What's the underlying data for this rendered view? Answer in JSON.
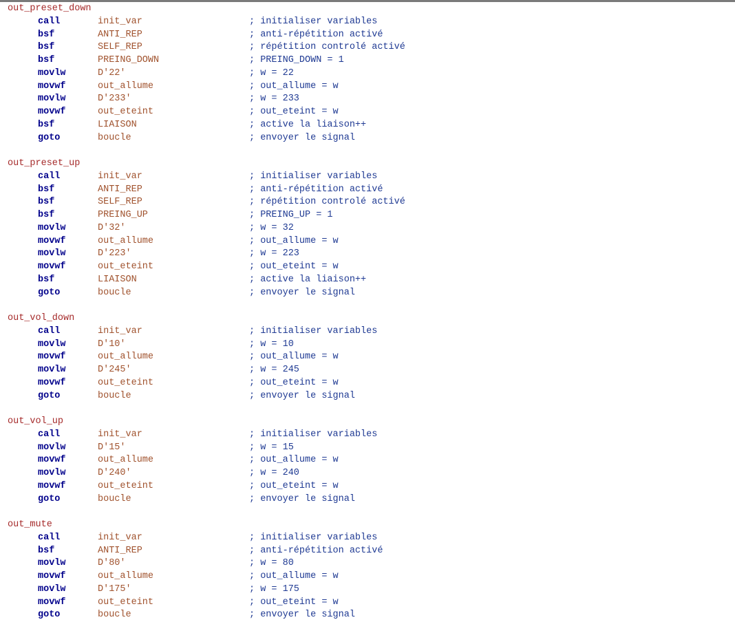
{
  "blocks": [
    {
      "label": "out_preset_down",
      "lines": [
        {
          "instr": "call",
          "operand": "init_var",
          "comment": "; initialiser variables"
        },
        {
          "instr": "bsf",
          "operand": "ANTI_REP",
          "comment": "; anti-répétition activé"
        },
        {
          "instr": "bsf",
          "operand": "SELF_REP",
          "comment": "; répétition controlé activé"
        },
        {
          "instr": "bsf",
          "operand": "PREING_DOWN",
          "comment": "; PREING_DOWN = 1"
        },
        {
          "instr": "movlw",
          "operand": "D'22'",
          "comment": "; w = 22"
        },
        {
          "instr": "movwf",
          "operand": "out_allume",
          "comment": "; out_allume = w"
        },
        {
          "instr": "movlw",
          "operand": "D'233'",
          "comment": "; w = 233"
        },
        {
          "instr": "movwf",
          "operand": "out_eteint",
          "comment": "; out_eteint = w"
        },
        {
          "instr": "bsf",
          "operand": "LIAISON",
          "comment": "; active la liaison++"
        },
        {
          "instr": "goto",
          "operand": "boucle",
          "comment": "; envoyer le signal"
        }
      ]
    },
    {
      "label": "out_preset_up",
      "lines": [
        {
          "instr": "call",
          "operand": "init_var",
          "comment": "; initialiser variables"
        },
        {
          "instr": "bsf",
          "operand": "ANTI_REP",
          "comment": "; anti-répétition activé"
        },
        {
          "instr": "bsf",
          "operand": "SELF_REP",
          "comment": "; répétition controlé activé"
        },
        {
          "instr": "bsf",
          "operand": "PREING_UP",
          "comment": "; PREING_UP = 1"
        },
        {
          "instr": "movlw",
          "operand": "D'32'",
          "comment": "; w = 32"
        },
        {
          "instr": "movwf",
          "operand": "out_allume",
          "comment": "; out_allume = w"
        },
        {
          "instr": "movlw",
          "operand": "D'223'",
          "comment": "; w = 223"
        },
        {
          "instr": "movwf",
          "operand": "out_eteint",
          "comment": "; out_eteint = w"
        },
        {
          "instr": "bsf",
          "operand": "LIAISON",
          "comment": "; active la liaison++"
        },
        {
          "instr": "goto",
          "operand": "boucle",
          "comment": "; envoyer le signal"
        }
      ]
    },
    {
      "label": "out_vol_down",
      "lines": [
        {
          "instr": "call",
          "operand": "init_var",
          "comment": "; initialiser variables"
        },
        {
          "instr": "movlw",
          "operand": "D'10'",
          "comment": "; w = 10"
        },
        {
          "instr": "movwf",
          "operand": "out_allume",
          "comment": "; out_allume = w"
        },
        {
          "instr": "movlw",
          "operand": "D'245'",
          "comment": "; w = 245"
        },
        {
          "instr": "movwf",
          "operand": "out_eteint",
          "comment": "; out_eteint = w"
        },
        {
          "instr": "goto",
          "operand": "boucle",
          "comment": "; envoyer le signal"
        }
      ]
    },
    {
      "label": "out_vol_up",
      "lines": [
        {
          "instr": "call",
          "operand": "init_var",
          "comment": "; initialiser variables"
        },
        {
          "instr": "movlw",
          "operand": "D'15'",
          "comment": "; w = 15"
        },
        {
          "instr": "movwf",
          "operand": "out_allume",
          "comment": "; out_allume = w"
        },
        {
          "instr": "movlw",
          "operand": "D'240'",
          "comment": "; w = 240"
        },
        {
          "instr": "movwf",
          "operand": "out_eteint",
          "comment": "; out_eteint = w"
        },
        {
          "instr": "goto",
          "operand": "boucle",
          "comment": "; envoyer le signal"
        }
      ]
    },
    {
      "label": "out_mute",
      "lines": [
        {
          "instr": "call",
          "operand": "init_var",
          "comment": "; initialiser variables"
        },
        {
          "instr": "bsf",
          "operand": "ANTI_REP",
          "comment": "; anti-répétition activé"
        },
        {
          "instr": "movlw",
          "operand": "D'80'",
          "comment": "; w = 80"
        },
        {
          "instr": "movwf",
          "operand": "out_allume",
          "comment": "; out_allume = w"
        },
        {
          "instr": "movlw",
          "operand": "D'175'",
          "comment": "; w = 175"
        },
        {
          "instr": "movwf",
          "operand": "out_eteint",
          "comment": "; out_eteint = w"
        },
        {
          "instr": "goto",
          "operand": "boucle",
          "comment": "; envoyer le signal"
        }
      ]
    }
  ],
  "colors": {
    "label": "#a52a2a",
    "instruction": "#00008b",
    "operand": "#a0522d",
    "comment": "#1f3a93",
    "top_rule": "#7a7a7a"
  }
}
